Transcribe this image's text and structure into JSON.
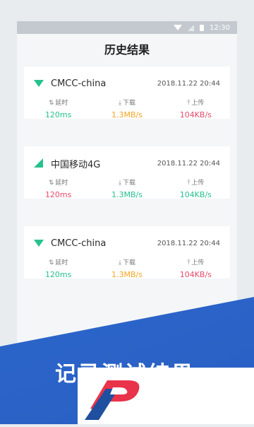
{
  "status": {
    "time": "12:30"
  },
  "header": {
    "title": "历史结果"
  },
  "records": [
    {
      "name": "CMCC-china",
      "type": "wifi",
      "datetime": "2018.11.22 20:44",
      "labels": {
        "latency": "延时",
        "download": "下载",
        "upload": "上传"
      },
      "latency": "120ms",
      "download": "1.3MB/s",
      "upload": "104KB/s"
    },
    {
      "name": "中国移动4G",
      "type": "cellular",
      "datetime": "2018.11.22 20:44",
      "labels": {
        "latency": "延时",
        "download": "下载",
        "upload": "上传"
      },
      "latency": "120ms",
      "download": "1.3MB/s",
      "upload": "104KB/s"
    },
    {
      "name": "CMCC-china",
      "type": "wifi",
      "datetime": "2018.11.22 20:44",
      "labels": {
        "latency": "延时",
        "download": "下载",
        "upload": "上传"
      },
      "latency": "120ms",
      "download": "1.3MB/s",
      "upload": "104KB/s"
    }
  ],
  "banner": {
    "text": "记录测试结果"
  },
  "colors": {
    "accent_green": "#26c28c",
    "orange": "#f5a623",
    "red": "#e84a6a",
    "banner_blue": "#2d6fd2"
  }
}
